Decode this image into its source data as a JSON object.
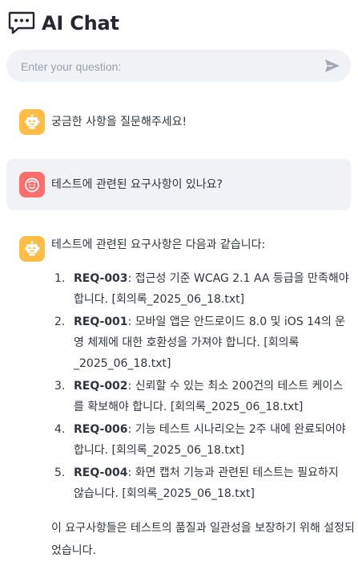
{
  "header": {
    "title": "AI Chat",
    "icon": "speech-bubble-icon"
  },
  "input": {
    "placeholder": "Enter your question:",
    "value": ""
  },
  "messages": [
    {
      "role": "assistant",
      "avatar": "robot-icon",
      "text": "궁금한 사항을 질문해주세요!"
    },
    {
      "role": "user",
      "avatar": "smiley-icon",
      "text": "테스트에 관련된 요구사항이 있나요?"
    },
    {
      "role": "assistant",
      "avatar": "robot-icon",
      "intro": "테스트에 관련된 요구사항은 다음과 같습니다:",
      "items": [
        {
          "num": "1.",
          "id": "REQ-003",
          "text": ": 접근성 기준 WCAG 2.1 AA 등급을 만족해야 합니다. [회의록_2025_06_18.txt]"
        },
        {
          "num": "2.",
          "id": "REQ-001",
          "text": ": 모바일 앱은 안드로이드 8.0 및 iOS 14의 운영 체제에 대한 호환성을 가져야 합니다. [회의록_2025_06_18.txt]"
        },
        {
          "num": "3.",
          "id": "REQ-002",
          "text": ": 신뢰할 수 있는 최소 200건의 테스트 케이스를 확보해야 합니다. [회의록_2025_06_18.txt]"
        },
        {
          "num": "4.",
          "id": "REQ-006",
          "text": ": 기능 테스트 시나리오는 2주 내에 완료되어야 합니다. [회의록_2025_06_18.txt]"
        },
        {
          "num": "5.",
          "id": "REQ-004",
          "text": ": 화면 캡처 기능과 관련된 테스트는 필요하지 않습니다. [회의록_2025_06_18.txt]"
        }
      ],
      "closing": "이 요구사항들은 테스트의 품질과 일관성을 보장하기 위해 설정되었습니다."
    }
  ],
  "colors": {
    "bot_avatar": "#ffbd45",
    "user_avatar": "#ff6c6c",
    "user_bubble": "#f0f2f6",
    "text": "#31333f"
  }
}
